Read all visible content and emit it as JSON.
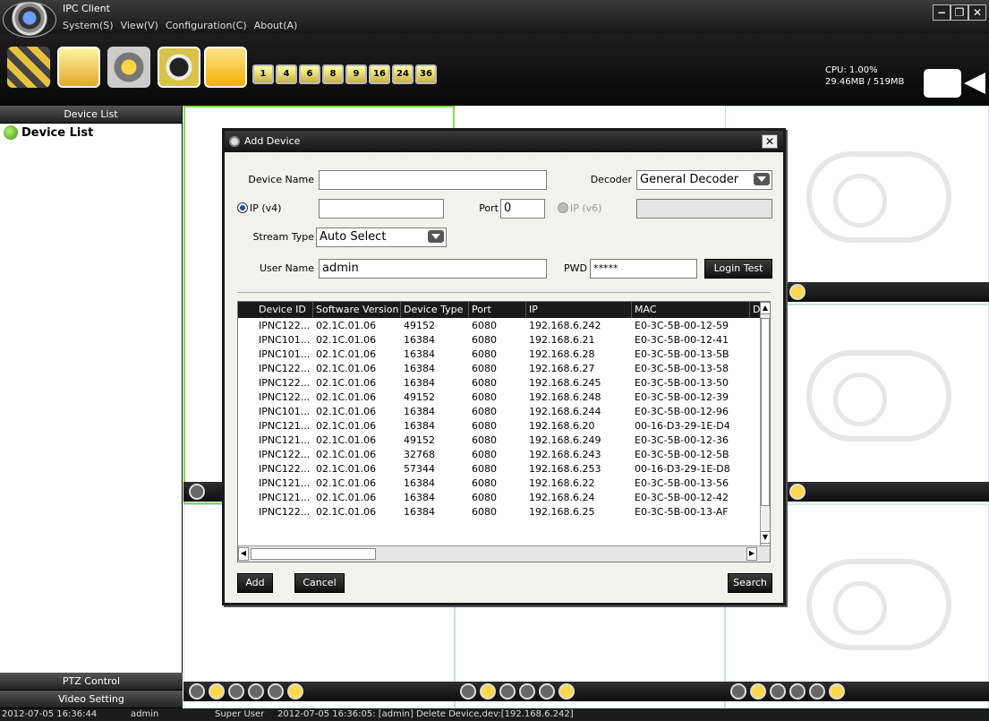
{
  "app": {
    "title": "IPC Client",
    "logo_icon": "webcam-logo"
  },
  "window_controls": {
    "minimize": "−",
    "restore": "❐",
    "close": "✕"
  },
  "menu": [
    "System(S)",
    "View(V)",
    "Configuration(C)",
    "About(A)"
  ],
  "toolbar": {
    "big_icons": [
      "device-manager-icon",
      "alarm-log-icon",
      "settings-icon",
      "playback-icon",
      "lock-icon"
    ],
    "layouts": [
      "1",
      "4",
      "6",
      "8",
      "9",
      "16",
      "24",
      "36"
    ],
    "cpu": "CPU: 1.00%",
    "memory": "29.46MB / 519MB"
  },
  "sidebar": {
    "header": "Device List",
    "tree_root": "Device List",
    "ptz": "PTZ Control",
    "video_setting": "Video Setting"
  },
  "dialog": {
    "title": "Add Device",
    "device_name_label": "Device Name",
    "device_name_value": "",
    "decoder_label": "Decoder",
    "decoder_value": "General Decoder",
    "ipv4_label": "IP (v4)",
    "ipv4_value": "",
    "port_label": "Port",
    "port_value": "0",
    "ipv6_label": "IP (v6)",
    "ipv6_value": "",
    "stream_type_label": "Stream Type",
    "stream_type_value": "Auto Select",
    "username_label": "User Name",
    "username_value": "admin",
    "pwd_label": "PWD",
    "pwd_value": "*****",
    "login_test": "Login Test",
    "add": "Add",
    "cancel": "Cancel",
    "search": "Search",
    "columns": [
      "Device ID",
      "Software Version",
      "Device Type",
      "Port",
      "IP",
      "MAC",
      "D"
    ],
    "rows": [
      [
        "IPNC122...",
        "02.1C.01.06",
        "49152",
        "6080",
        "192.168.6.242",
        "E0-3C-5B-00-12-59"
      ],
      [
        "IPNC101...",
        "02.1C.01.06",
        "16384",
        "6080",
        "192.168.6.21",
        "E0-3C-5B-00-12-41"
      ],
      [
        "IPNC101...",
        "02.1C.01.06",
        "16384",
        "6080",
        "192.168.6.28",
        "E0-3C-5B-00-13-5B"
      ],
      [
        "IPNC122...",
        "02.1C.01.06",
        "16384",
        "6080",
        "192.168.6.27",
        "E0-3C-5B-00-13-58"
      ],
      [
        "IPNC122...",
        "02.1C.01.06",
        "16384",
        "6080",
        "192.168.6.245",
        "E0-3C-5B-00-13-50"
      ],
      [
        "IPNC122...",
        "02.1C.01.06",
        "49152",
        "6080",
        "192.168.6.248",
        "E0-3C-5B-00-12-39"
      ],
      [
        "IPNC101...",
        "02.1C.01.06",
        "16384",
        "6080",
        "192.168.6.244",
        "E0-3C-5B-00-12-96"
      ],
      [
        "IPNC121...",
        "02.1C.01.06",
        "16384",
        "6080",
        "192.168.6.20",
        "00-16-D3-29-1E-D4"
      ],
      [
        "IPNC121...",
        "02.1C.01.06",
        "49152",
        "6080",
        "192.168.6.249",
        "E0-3C-5B-00-12-36"
      ],
      [
        "IPNC122...",
        "02.1C.01.06",
        "32768",
        "6080",
        "192.168.6.243",
        "E0-3C-5B-00-12-5B"
      ],
      [
        "IPNC122...",
        "02.1C.01.06",
        "57344",
        "6080",
        "192.168.6.253",
        "00-16-D3-29-1E-D8"
      ],
      [
        "IPNC121...",
        "02.1C.01.06",
        "16384",
        "6080",
        "192.168.6.22",
        "E0-3C-5B-00-13-56"
      ],
      [
        "IPNC121...",
        "02.1C.01.06",
        "16384",
        "6080",
        "192.168.6.24",
        "E0-3C-5B-00-12-42"
      ],
      [
        "IPNC122...",
        "02.1C.01.06",
        "16384",
        "6080",
        "192.168.6.25",
        "E0-3C-5B-00-13-AF"
      ]
    ]
  },
  "video_controls": [
    "talk-icon",
    "record-icon",
    "snapshot-icon",
    "audio-icon",
    "save-icon",
    "zoom-icon"
  ],
  "status": {
    "datetime": "2012-07-05 16:36:44",
    "user": "admin",
    "role": "Super User",
    "message": "2012-07-05 16:36:05: [admin] Delete Device,dev:[192.168.6.242]"
  }
}
